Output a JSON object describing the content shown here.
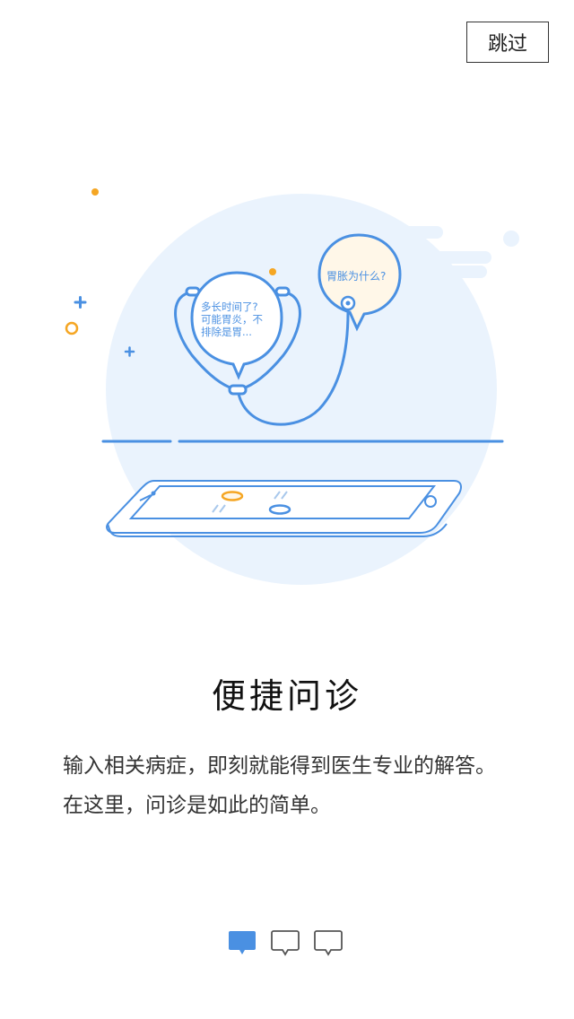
{
  "skip_label": "跳过",
  "illustration": {
    "doctor_bubble": [
      "多长时间了?",
      "可能胃炎，不",
      "排除是胃..."
    ],
    "patient_bubble": "胃胀为什么?",
    "colors": {
      "primary": "#4a90e2",
      "circle_bg": "#eaf3fd",
      "accent_orange": "#f5a623"
    }
  },
  "title": "便捷问诊",
  "description": {
    "line1": "输入相关病症，即刻就能得到医生专业的解答。",
    "line2": "在这里，问诊是如此的简单。"
  },
  "pager": {
    "total": 3,
    "active_index": 0,
    "icon": "chat-bubble-icon"
  }
}
